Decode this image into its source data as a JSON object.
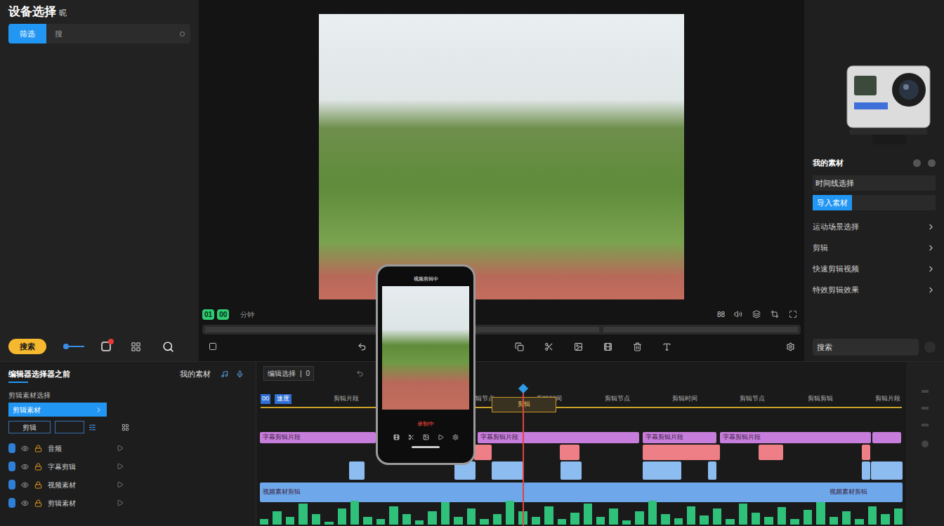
{
  "left_panel": {
    "title": "设备选择",
    "title_suffix": "昵",
    "search_button": "筛选",
    "search_text": "搜",
    "toolbar_button": "搜索",
    "badge": true
  },
  "preview": {
    "timecode": [
      "01",
      "00"
    ],
    "label": "分钟",
    "track_label": "88"
  },
  "right_panel": {
    "title": "我的素材",
    "field": "时间线选择",
    "button": "导入素材",
    "items": [
      "运动场景选择",
      "剪辑",
      "快速剪辑视频",
      "特效剪辑效果"
    ],
    "search": "搜索"
  },
  "phone": {
    "title": "视频剪辑中",
    "status": "录制中"
  },
  "editor": {
    "title": "编辑器选择器之前",
    "tabs_label": "我的素材",
    "section": "剪辑素材选择",
    "picker": "剪辑素材",
    "field": "剪辑",
    "track_labels": [
      "音频",
      "字幕剪辑",
      "视频素材",
      "剪辑素材"
    ]
  },
  "timeline": {
    "header": "编辑选择",
    "header_count": "0",
    "marker": "00",
    "marker_label": "速度",
    "ruler": [
      "剪辑片段",
      "剪辑时间",
      "剪辑节点",
      "剪辑时间",
      "剪辑节点",
      "剪辑时间",
      "剪辑节点",
      "剪辑剪辑",
      "剪辑片段"
    ],
    "selection_label": "剪辑",
    "playhead": 0.41
  },
  "tracks": [
    {
      "label": "字幕剪辑片段",
      "color": "#c77ddb"
    },
    {
      "color": "#ef7f86"
    },
    {
      "color": "#8dbdf0"
    },
    {
      "label": "视频素材剪辑",
      "color": "#6fa8ea"
    }
  ],
  "waveform": [
    0.2,
    0.5,
    0.3,
    0.8,
    0.4,
    0.1,
    0.6,
    0.9,
    0.3,
    0.2,
    0.7,
    0.4,
    0.15,
    0.5,
    0.85,
    0.3,
    0.6,
    0.2,
    0.4,
    0.9,
    0.5,
    0.3,
    0.7,
    0.2,
    0.45,
    0.8,
    0.3,
    0.6,
    0.15,
    0.5,
    0.9,
    0.4,
    0.25,
    0.7,
    0.35,
    0.6,
    0.2,
    0.8,
    0.45,
    0.3,
    0.65,
    0.2,
    0.55,
    0.85,
    0.3,
    0.5,
    0.2,
    0.7,
    0.4,
    0.6
  ]
}
